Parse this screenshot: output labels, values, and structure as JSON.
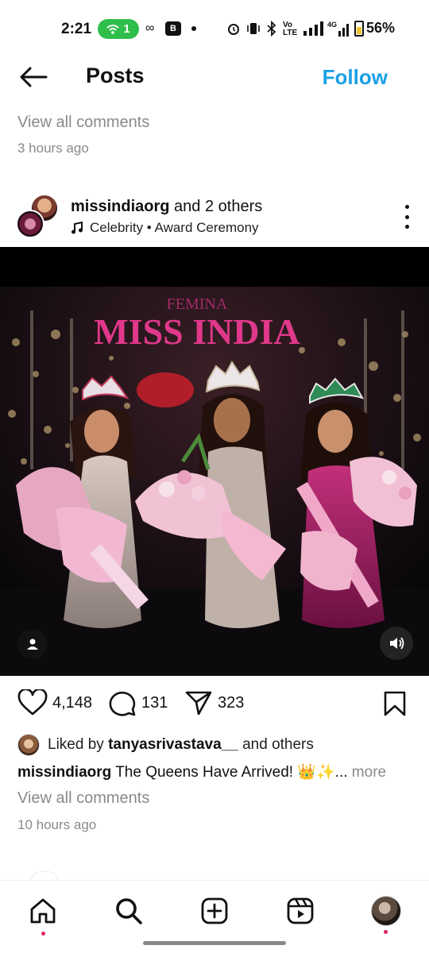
{
  "status_bar": {
    "time": "2:21",
    "hotspot_count": "1",
    "battery": "56%"
  },
  "header": {
    "title": "Posts",
    "follow_label": "Follow"
  },
  "previous_post": {
    "view_comments": "View all comments",
    "time": "3 hours ago"
  },
  "post": {
    "author": "missindiaorg",
    "author_suffix": "and 2 others",
    "audio_label": "Celebrity • Award Ceremony",
    "image_banner": "MISS INDIA",
    "image_banner_top": "FEMINA",
    "likes": "4,148",
    "comments": "131",
    "shares": "323",
    "liked_by_prefix": "Liked by",
    "liked_by_user": "tanyasrivastava__",
    "liked_by_suffix": "and others",
    "caption_user": "missindiaorg",
    "caption_text": "The Queens Have Arrived! 👑✨...",
    "caption_more": "more",
    "view_comments": "View all comments",
    "time": "10 hours ago"
  },
  "icons": {
    "back": "arrow-left-icon",
    "music": "music-note-icon",
    "more": "more-vertical-icon",
    "user_tag": "user-tag-icon",
    "volume": "volume-icon",
    "like": "heart-icon",
    "comment": "comment-icon",
    "share": "send-icon",
    "save": "bookmark-icon",
    "home": "home-icon",
    "search": "search-icon",
    "create": "plus-square-icon",
    "reels": "reels-icon"
  },
  "colors": {
    "accent": "#1aa0e6",
    "hotspot": "#2fbf4a",
    "notification_dot": "#e0245e"
  }
}
